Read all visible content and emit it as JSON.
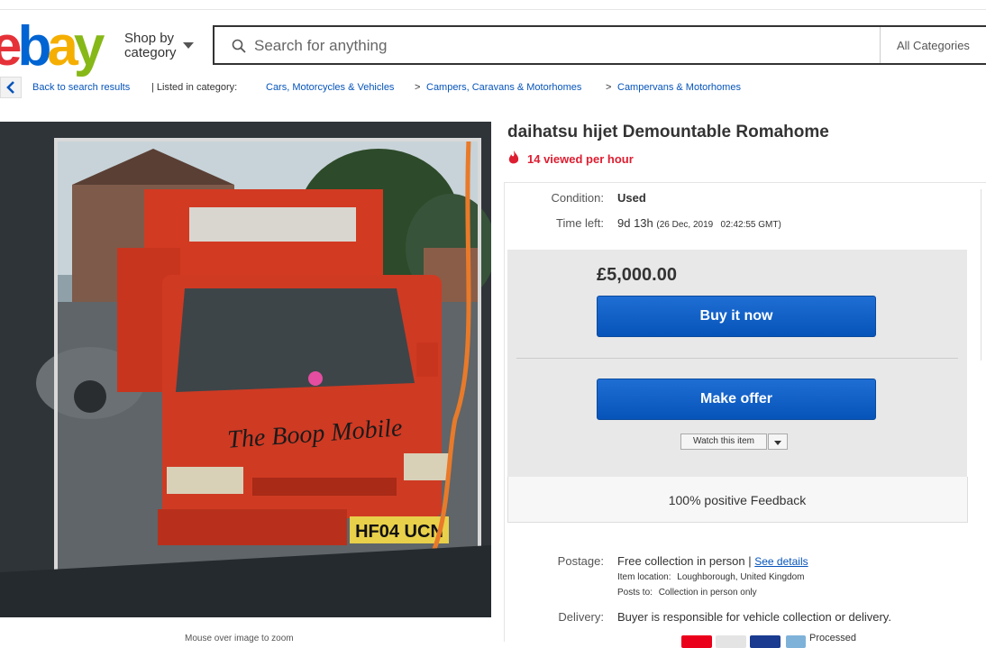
{
  "header": {
    "logo_letters": [
      "e",
      "b",
      "a",
      "y"
    ],
    "logo_colors": [
      "#e53238",
      "#0064d2",
      "#f5af02",
      "#86b817"
    ],
    "shop_by_line1": "Shop by",
    "shop_by_line2": "category",
    "search_placeholder": "Search for anything",
    "categories_label": "All Categories"
  },
  "breadcrumb": {
    "back_label": "Back to search results",
    "listed_label": "| Listed in category:",
    "crumbs": [
      "Cars, Motorcycles & Vehicles",
      "Campers, Caravans & Motorhomes",
      "Campervans & Motorhomes"
    ],
    "separator": ">"
  },
  "listing": {
    "title": "daihatsu hijet Demountable Romahome",
    "viewed": "14 viewed per hour",
    "condition_label": "Condition:",
    "condition_value": "Used",
    "time_left_label": "Time left:",
    "time_left_value": "9d 13h",
    "time_left_detail": "(26 Dec, 2019   02:42:55 GMT)",
    "price": "£5,000.00",
    "buy_now_label": "Buy it now",
    "make_offer_label": "Make offer",
    "watch_label": "Watch this item",
    "feedback": "100% positive Feedback",
    "image_caption": "Mouse over image to zoom",
    "plate_text": "HF04 UCN",
    "van_lettering": "The Boop Mobile"
  },
  "shipping": {
    "postage_label": "Postage:",
    "postage_value": "Free collection in person |",
    "see_details": "See details",
    "item_location_label": "Item location:",
    "item_location_value": "Loughborough, United Kingdom",
    "posts_to_label": "Posts to:",
    "posts_to_value": "Collection in person only",
    "delivery_label": "Delivery:",
    "delivery_value": "Buyer is responsible for vehicle collection or delivery.",
    "processed": "Processed"
  },
  "colors": {
    "link": "#0654ba",
    "accent_red": "#dd1e31",
    "button_blue": "#0654ba"
  }
}
